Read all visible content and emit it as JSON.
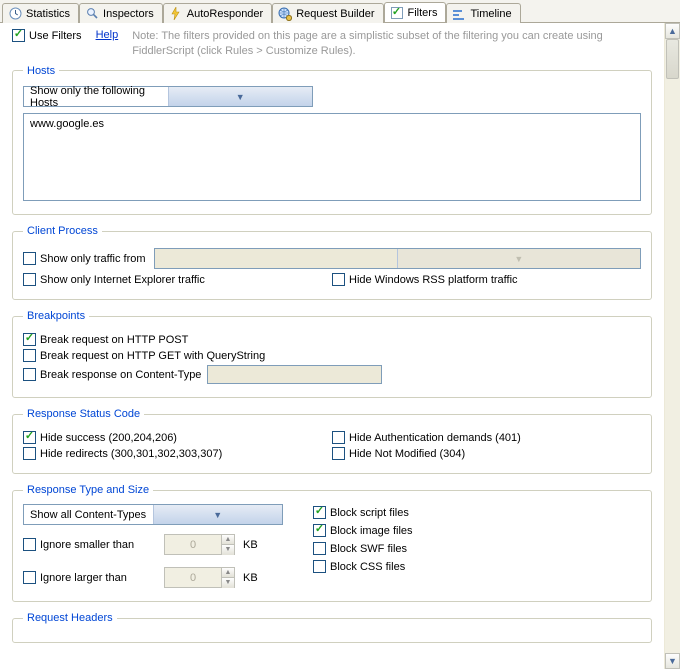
{
  "tabs": {
    "statistics": "Statistics",
    "inspectors": "Inspectors",
    "autoresponder": "AutoResponder",
    "request_builder": "Request Builder",
    "filters": "Filters",
    "timeline": "Timeline"
  },
  "top": {
    "use_filters": "Use Filters",
    "help": "Help",
    "note": "Note: The filters provided on this page are a simplistic subset of the filtering you can create using FiddlerScript (click Rules > Customize Rules)."
  },
  "hosts": {
    "legend": "Hosts",
    "mode": "Show only the following Hosts",
    "list": "www.google.es"
  },
  "client_process": {
    "legend": "Client Process",
    "show_only_from": "Show only traffic from",
    "show_only_ie": "Show only Internet Explorer traffic",
    "hide_rss": "Hide Windows RSS platform traffic"
  },
  "breakpoints": {
    "legend": "Breakpoints",
    "post": "Break request on HTTP POST",
    "get_qs": "Break request on HTTP GET with QueryString",
    "resp_ct": "Break response on Content-Type"
  },
  "status_code": {
    "legend": "Response Status Code",
    "hide_success": "Hide success (200,204,206)",
    "hide_redirects": "Hide redirects (300,301,302,303,307)",
    "hide_auth": "Hide Authentication demands (401)",
    "hide_304": "Hide Not Modified (304)"
  },
  "type_size": {
    "legend": "Response Type and Size",
    "ct_mode": "Show all Content-Types",
    "ignore_smaller": "Ignore smaller than",
    "ignore_larger": "Ignore larger than",
    "kb": "KB",
    "zero": "0",
    "block_script": "Block script files",
    "block_image": "Block image files",
    "block_swf": "Block SWF files",
    "block_css": "Block CSS files"
  },
  "request_headers": {
    "legend": "Request Headers"
  }
}
